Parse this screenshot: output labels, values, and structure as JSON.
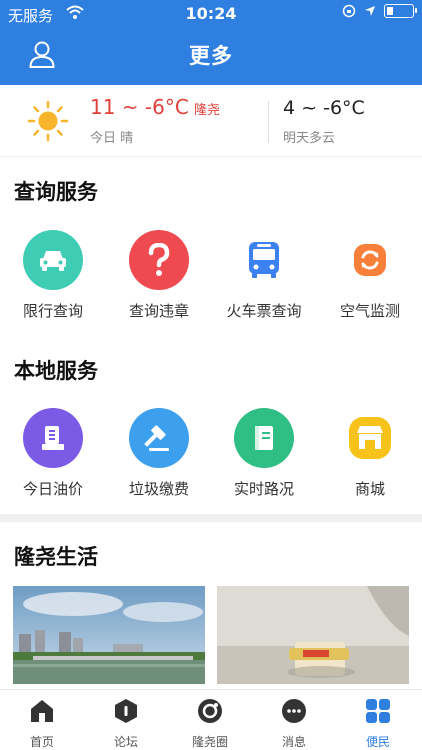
{
  "status_bar": {
    "carrier": "无服务",
    "time": "10:24"
  },
  "header": {
    "title": "更多"
  },
  "weather": {
    "today_temp": "11 ~ -6°C",
    "city": "隆尧",
    "today_desc": "今日 晴",
    "tomorrow_temp": "4 ~ -6°C",
    "tomorrow_desc": "明天多云"
  },
  "query_services": {
    "title": "查询服务",
    "items": [
      {
        "label": "限行查询",
        "icon": "car-icon",
        "color": "#3ecdb4"
      },
      {
        "label": "查询违章",
        "icon": "question-icon",
        "color": "#ef4a4f"
      },
      {
        "label": "火车票查询",
        "icon": "bus-icon",
        "color": "#3b82f0"
      },
      {
        "label": "空气监测",
        "icon": "refresh-icon",
        "color": "#f77f3a"
      }
    ]
  },
  "local_services": {
    "title": "本地服务",
    "items": [
      {
        "label": "今日油价",
        "icon": "oil-icon",
        "color": "#7b5ae6"
      },
      {
        "label": "垃圾缴费",
        "icon": "gavel-icon",
        "color": "#3da0ef"
      },
      {
        "label": "实时路况",
        "icon": "book-icon",
        "color": "#2fbe84"
      },
      {
        "label": "商城",
        "icon": "shop-icon",
        "color": "#f7c21a"
      }
    ]
  },
  "life": {
    "title": "隆尧生活"
  },
  "tabbar": {
    "items": [
      {
        "label": "首页",
        "icon": "home-icon"
      },
      {
        "label": "论坛",
        "icon": "forum-icon"
      },
      {
        "label": "隆尧圈",
        "icon": "circle-icon"
      },
      {
        "label": "消息",
        "icon": "message-icon"
      },
      {
        "label": "便民",
        "icon": "grid-icon",
        "active": true
      }
    ]
  },
  "colors": {
    "primary": "#2f7fe0",
    "temp_red": "#e0403a"
  }
}
